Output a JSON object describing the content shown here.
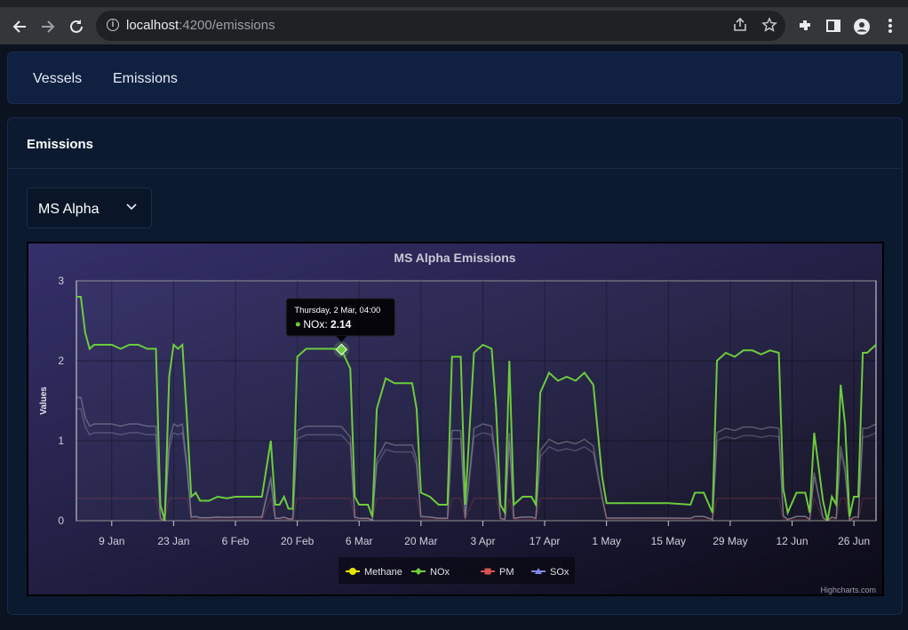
{
  "browser": {
    "url_host": "localhost",
    "url_path": ":4200/emissions",
    "back_icon": "back-arrow-icon",
    "forward_icon": "forward-arrow-icon",
    "reload_icon": "reload-icon"
  },
  "nav": {
    "items": [
      {
        "label": "Vessels"
      },
      {
        "label": "Emissions"
      }
    ]
  },
  "card": {
    "title": "Emissions",
    "select": {
      "value": "MS Alpha"
    }
  },
  "chart_data": {
    "type": "line",
    "title": "MS Alpha Emissions",
    "ylabel": "Values",
    "xlabel": "",
    "ylim": [
      0,
      3
    ],
    "yticks": [
      "0",
      "1",
      "2",
      "3"
    ],
    "xtick_labels": [
      "9 Jan",
      "23 Jan",
      "6 Feb",
      "20 Feb",
      "6 Mar",
      "20 Mar",
      "3 Apr",
      "17 Apr",
      "1 May",
      "15 May",
      "29 May",
      "12 Jun",
      "26 Jun"
    ],
    "x_start": "2023-01-01",
    "x_end": "2023-07-01",
    "grid": true,
    "legend_position": "bottom-center",
    "credits": "Highcharts.com",
    "tooltip": {
      "header": "Thursday, 2 Mar, 04:00",
      "series": "NOx",
      "value": "2.14"
    },
    "series": [
      {
        "name": "Methane",
        "color": "#e6e600",
        "marker": "circle"
      },
      {
        "name": "NOx",
        "color": "#6ccc3c",
        "marker": "diamond",
        "x": [
          "2023-01-01",
          "2023-01-02",
          "2023-01-03",
          "2023-01-04",
          "2023-01-05",
          "2023-01-07",
          "2023-01-09",
          "2023-01-11",
          "2023-01-13",
          "2023-01-15",
          "2023-01-17",
          "2023-01-19",
          "2023-01-20",
          "2023-01-21",
          "2023-01-22",
          "2023-01-23",
          "2023-01-24",
          "2023-01-25",
          "2023-01-26",
          "2023-01-27",
          "2023-01-28",
          "2023-01-29",
          "2023-01-31",
          "2023-02-02",
          "2023-02-04",
          "2023-02-06",
          "2023-02-08",
          "2023-02-10",
          "2023-02-12",
          "2023-02-14",
          "2023-02-15",
          "2023-02-16",
          "2023-02-17",
          "2023-02-18",
          "2023-02-19",
          "2023-02-20",
          "2023-02-22",
          "2023-02-24",
          "2023-02-26",
          "2023-02-28",
          "2023-03-02",
          "2023-03-04",
          "2023-03-05",
          "2023-03-06",
          "2023-03-08",
          "2023-03-09",
          "2023-03-10",
          "2023-03-12",
          "2023-03-14",
          "2023-03-16",
          "2023-03-18",
          "2023-03-19",
          "2023-03-20",
          "2023-03-22",
          "2023-03-24",
          "2023-03-26",
          "2023-03-27",
          "2023-03-29",
          "2023-03-30",
          "2023-04-01",
          "2023-04-03",
          "2023-04-05",
          "2023-04-06",
          "2023-04-07",
          "2023-04-08",
          "2023-04-09",
          "2023-04-10",
          "2023-04-12",
          "2023-04-14",
          "2023-04-15",
          "2023-04-16",
          "2023-04-18",
          "2023-04-20",
          "2023-04-22",
          "2023-04-24",
          "2023-04-26",
          "2023-04-28",
          "2023-04-30",
          "2023-05-01",
          "2023-05-05",
          "2023-05-10",
          "2023-05-15",
          "2023-05-20",
          "2023-05-21",
          "2023-05-23",
          "2023-05-25",
          "2023-05-26",
          "2023-05-28",
          "2023-05-30",
          "2023-06-01",
          "2023-06-03",
          "2023-06-05",
          "2023-06-07",
          "2023-06-09",
          "2023-06-10",
          "2023-06-11",
          "2023-06-13",
          "2023-06-15",
          "2023-06-16",
          "2023-06-17",
          "2023-06-19",
          "2023-06-20",
          "2023-06-21",
          "2023-06-22",
          "2023-06-23",
          "2023-06-24",
          "2023-06-25",
          "2023-06-26",
          "2023-06-27",
          "2023-06-28",
          "2023-06-29",
          "2023-06-30",
          "2023-07-01"
        ],
        "y": [
          2.8,
          2.8,
          2.35,
          2.15,
          2.2,
          2.2,
          2.2,
          2.15,
          2.2,
          2.2,
          2.15,
          2.15,
          0.2,
          0.0,
          1.8,
          2.2,
          2.15,
          2.2,
          1.3,
          0.3,
          0.35,
          0.25,
          0.25,
          0.3,
          0.28,
          0.3,
          0.3,
          0.3,
          0.3,
          1.0,
          0.2,
          0.2,
          0.3,
          0.15,
          0.15,
          2.05,
          2.15,
          2.15,
          2.15,
          2.15,
          2.14,
          1.9,
          0.3,
          0.2,
          0.2,
          0.05,
          1.4,
          1.78,
          1.72,
          1.72,
          1.72,
          1.4,
          0.35,
          0.3,
          0.2,
          0.2,
          2.05,
          2.05,
          0.2,
          2.1,
          2.2,
          2.15,
          1.4,
          0.2,
          0.1,
          2.0,
          0.2,
          0.3,
          0.3,
          0.2,
          1.6,
          1.85,
          1.75,
          1.8,
          1.75,
          1.85,
          1.7,
          0.55,
          0.22,
          0.22,
          0.22,
          0.22,
          0.2,
          0.35,
          0.35,
          0.1,
          2.0,
          2.1,
          2.05,
          2.13,
          2.13,
          2.08,
          2.13,
          2.1,
          0.4,
          0.1,
          0.35,
          0.35,
          0.1,
          1.1,
          0.25,
          0.0,
          0.3,
          0.2,
          1.7,
          1.2,
          0.05,
          0.3,
          0.3,
          2.1,
          2.1,
          2.15,
          2.2
        ]
      },
      {
        "name": "PM",
        "color": "#d9534f",
        "marker": "square"
      },
      {
        "name": "SOx",
        "color": "#8087e8",
        "marker": "triangle"
      }
    ]
  }
}
